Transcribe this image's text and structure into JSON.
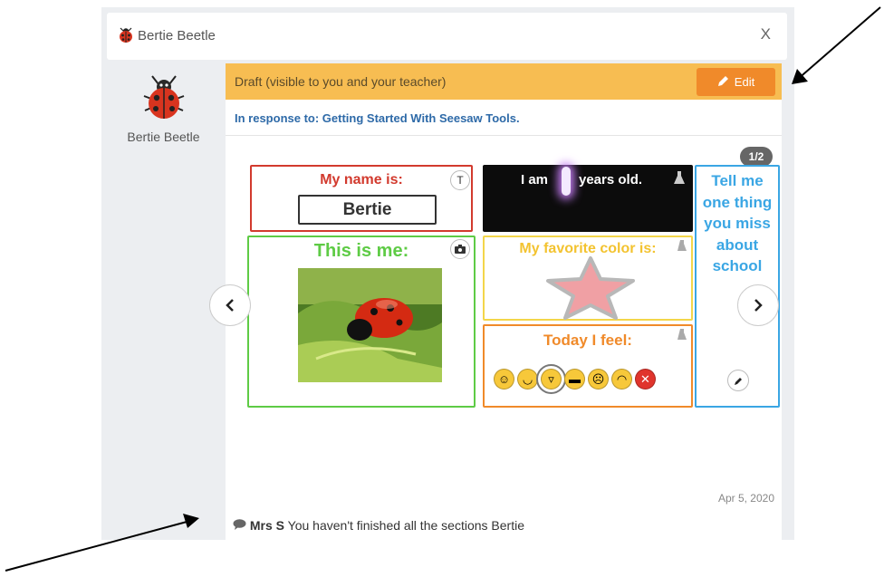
{
  "window": {
    "title": "Bertie Beetle",
    "close_label": "X"
  },
  "author": {
    "name": "Bertie Beetle"
  },
  "draft": {
    "label": "Draft (visible to you and your teacher)",
    "edit_label": "Edit"
  },
  "response": {
    "text": "In response to: Getting Started With Seesaw Tools."
  },
  "pager": {
    "label": "1/2"
  },
  "slide": {
    "name_box": {
      "title": "My name is:",
      "value": "Bertie",
      "tool": "T"
    },
    "age_box": {
      "before": "I am",
      "after": "years old."
    },
    "me_box": {
      "title": "This is me:"
    },
    "color_box": {
      "title": "My favorite color is:"
    },
    "feel_box": {
      "title": "Today I feel:"
    },
    "miss_box": {
      "title": "Tell me one thing you miss about school"
    }
  },
  "post": {
    "date": "Apr 5, 2020"
  },
  "comment": {
    "author": "Mrs S",
    "text": "You haven't finished all the sections Bertie"
  },
  "colors": {
    "draft": "#f7bd52",
    "edit": "#f08a2a",
    "link": "#2e6aa8"
  }
}
